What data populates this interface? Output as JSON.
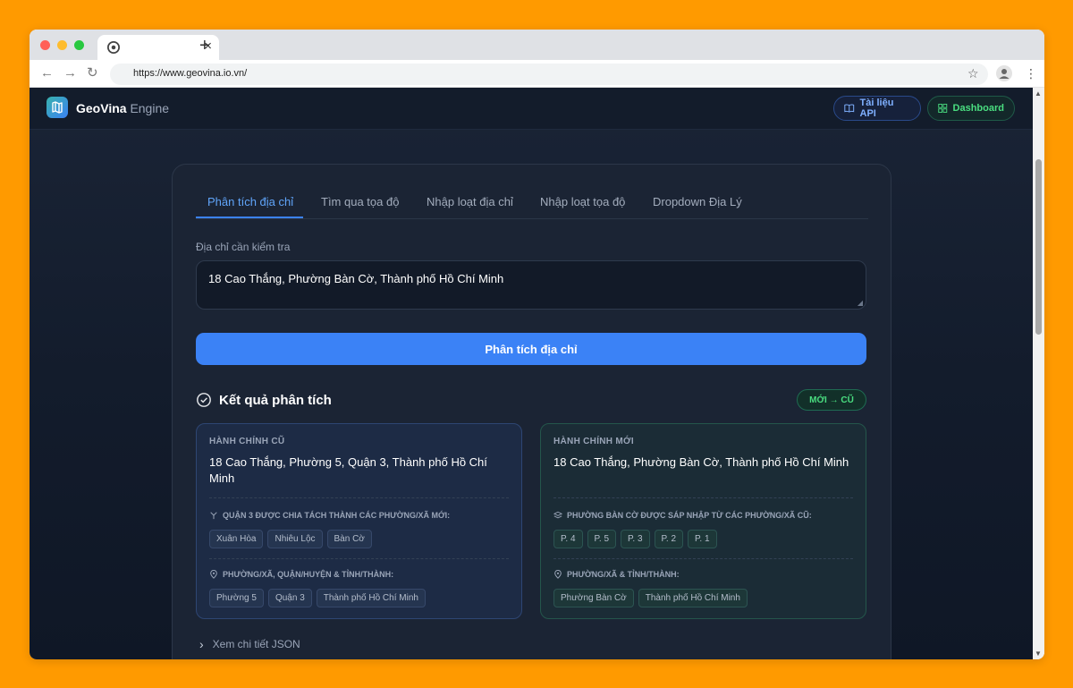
{
  "browser": {
    "url": "https://www.geovina.io.vn/"
  },
  "header": {
    "brand_bold": "GeoVina",
    "brand_light": "Engine",
    "api_docs_label": "Tài liệu API",
    "dashboard_label": "Dashboard"
  },
  "tabs": [
    {
      "label": "Phân tích địa chỉ"
    },
    {
      "label": "Tìm qua tọa độ"
    },
    {
      "label": "Nhập loạt địa chỉ"
    },
    {
      "label": "Nhập loạt tọa độ"
    },
    {
      "label": "Dropdown Địa Lý"
    }
  ],
  "form": {
    "address_label": "Địa chỉ cần kiểm tra",
    "address_value": "18 Cao Thắng, Phường Bàn Cờ, Thành phố Hồ Chí Minh",
    "submit_label": "Phân tích địa chỉ"
  },
  "result": {
    "title": "Kết quả phân tích",
    "badge": "MỚI → CŨ",
    "old": {
      "heading": "HÀNH CHÍNH CŨ",
      "address": "18 Cao Thắng, Phường 5, Quận 3, Thành phố Hồ Chí Minh",
      "split_heading": "QUẬN 3 ĐƯỢC CHIA TÁCH THÀNH CÁC PHƯỜNG/XÃ MỚI:",
      "split_chips": [
        "Xuân Hòa",
        "Nhiêu Lộc",
        "Bàn Cờ"
      ],
      "admin_heading": "PHƯỜNG/XÃ, QUẬN/HUYỆN & TỈNH/THÀNH:",
      "admin_chips": [
        "Phường 5",
        "Quận 3",
        "Thành phố Hồ Chí Minh"
      ]
    },
    "new": {
      "heading": "HÀNH CHÍNH MỚI",
      "address": "18 Cao Thắng, Phường Bàn Cờ, Thành phố Hồ Chí Minh",
      "merge_heading": "PHƯỜNG BÀN CỜ ĐƯỢC SÁP NHẬP TỪ CÁC PHƯỜNG/XÃ CŨ:",
      "merge_chips": [
        "P. 4",
        "P. 5",
        "P. 3",
        "P. 2",
        "P. 1"
      ],
      "admin_heading": "PHƯỜNG/XÃ & TỈNH/THÀNH:",
      "admin_chips": [
        "Phường Bàn Cờ",
        "Thành phố Hồ Chí Minh"
      ]
    },
    "json_toggle": "Xem chi tiết JSON"
  }
}
